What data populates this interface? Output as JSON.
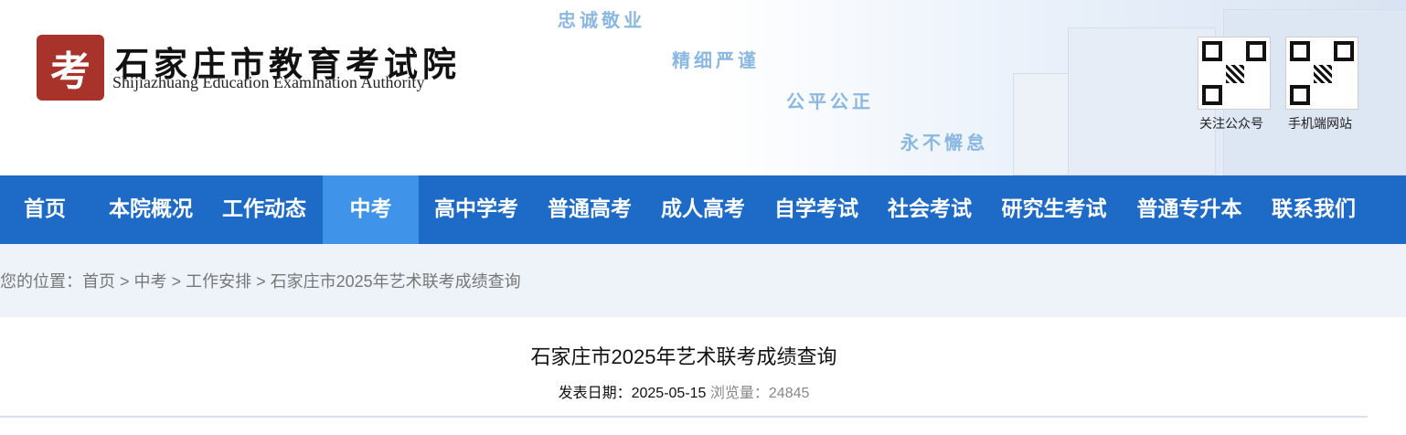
{
  "header": {
    "logo_seal_char": "考",
    "logo_cn": "石家庄市教育考试院",
    "logo_en": "Shijiazhuang Education Examination Authority",
    "slogans": [
      "忠诚敬业",
      "精细严谨",
      "公平公正",
      "永不懈怠"
    ],
    "qr_codes": [
      {
        "label": "关注公众号"
      },
      {
        "label": "手机端网站"
      }
    ]
  },
  "nav": {
    "items": [
      {
        "label": "首页"
      },
      {
        "label": "本院概况"
      },
      {
        "label": "工作动态"
      },
      {
        "label": "中考",
        "active": true
      },
      {
        "label": "高中学考"
      },
      {
        "label": "普通高考"
      },
      {
        "label": "成人高考"
      },
      {
        "label": "自学考试"
      },
      {
        "label": "社会考试"
      },
      {
        "label": "研究生考试"
      },
      {
        "label": "普通专升本"
      },
      {
        "label": "联系我们"
      }
    ],
    "active_color": "#3f93e8",
    "bar_color": "#1d6ac7"
  },
  "breadcrumb": {
    "prefix": "您的位置：",
    "items": [
      "首页",
      "中考",
      "工作安排",
      "石家庄市2025年艺术联考成绩查询"
    ],
    "separator": ">"
  },
  "article": {
    "title": "石家庄市2025年艺术联考成绩查询",
    "date_label": "发表日期：",
    "date_value": "2025-05-15",
    "views_label": "浏览量：",
    "views_value": "24845"
  }
}
